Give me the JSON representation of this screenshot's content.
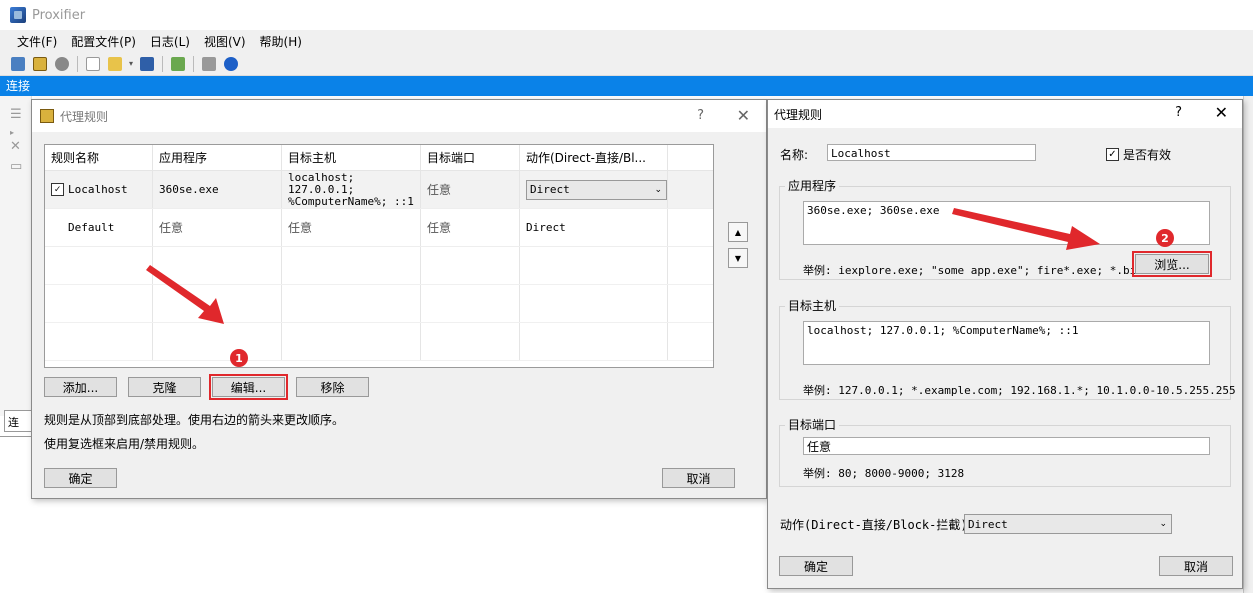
{
  "app": {
    "title": "Proxifier",
    "menu": [
      "文件(F)",
      "配置文件(P)",
      "日志(L)",
      "视图(V)",
      "帮助(H)"
    ],
    "connections_label": "连接",
    "bottom_tab": "连"
  },
  "rules_dialog": {
    "title": "代理规则",
    "help": "?",
    "close": "✕",
    "columns": [
      "规则名称",
      "应用程序",
      "目标主机",
      "目标端口",
      "动作(Direct-直接/Bl..."
    ],
    "rows": [
      {
        "name": "Localhost",
        "app": "360se.exe",
        "host_line1": "localhost; 127.0.0.1;",
        "host_line2": "%ComputerName%; ::1",
        "port": "任意",
        "action": "Direct",
        "checked": true
      },
      {
        "name": "Default",
        "app": "任意",
        "host_line1": "任意",
        "host_line2": "",
        "port": "任意",
        "action": "Direct",
        "checked": false
      }
    ],
    "buttons": {
      "add": "添加...",
      "clone": "克隆",
      "edit": "编辑...",
      "remove": "移除",
      "ok": "确定",
      "cancel": "取消"
    },
    "info1": "规则是从顶部到底部处理。使用右边的箭头来更改顺序。",
    "info2": "使用复选框来启用/禁用规则。",
    "badge": "1"
  },
  "edit_dialog": {
    "title": "代理规则",
    "help": "?",
    "close": "✕",
    "name_label": "名称:",
    "name_value": "Localhost",
    "enabled_label": "是否有效",
    "app_group": "应用程序",
    "app_value": "360se.exe; 360se.exe",
    "app_example": "举例: iexplore.exe; \"some app.exe\"; fire*.exe; *.bin",
    "browse": "浏览...",
    "host_group": "目标主机",
    "host_value": "localhost; 127.0.0.1; %ComputerName%; ::1",
    "host_example": "举例: 127.0.0.1; *.example.com; 192.168.1.*; 10.1.0.0-10.5.255.255",
    "port_group": "目标端口",
    "port_value": "任意",
    "port_example": "举例: 80; 8000-9000; 3128",
    "action_label": "动作(Direct-直接/Block-拦截):",
    "action_value": "Direct",
    "ok": "确定",
    "cancel": "取消",
    "badge": "2"
  },
  "colors": {
    "accent": "#0a82e8",
    "highlight": "#e0282c"
  }
}
